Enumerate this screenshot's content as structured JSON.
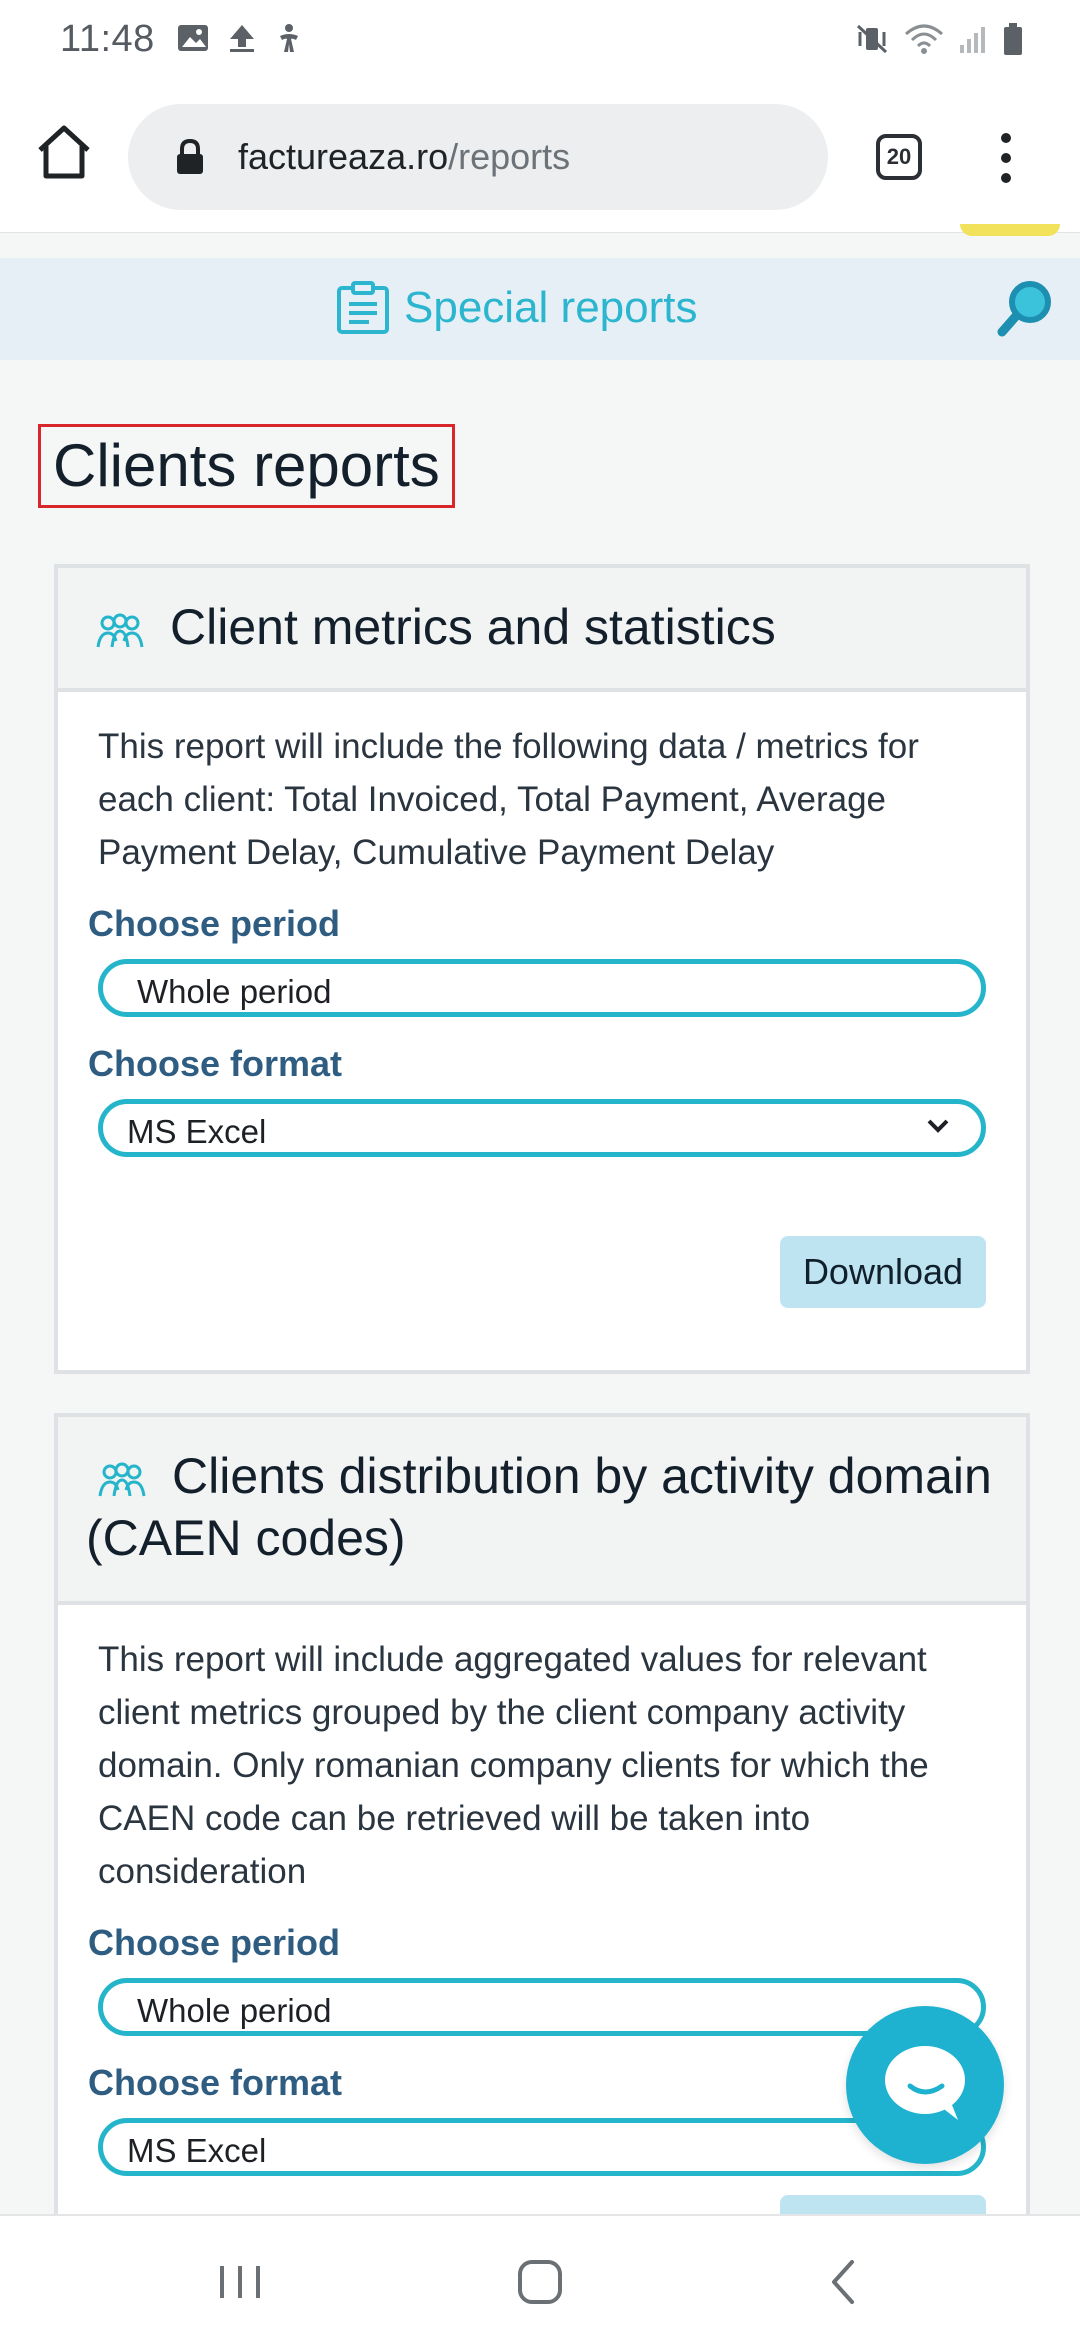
{
  "status_bar": {
    "time": "11:48",
    "left_icons": [
      "image-icon",
      "upload-icon",
      "accessibility-icon"
    ],
    "right_icons": [
      "mute-vibrate-icon",
      "wifi-icon",
      "signal-icon",
      "battery-icon"
    ]
  },
  "browser": {
    "url_host": "factureaza.ro",
    "url_path": "/reports",
    "tab_count": "20"
  },
  "page": {
    "special_reports_label": "Special reports",
    "title": "Clients reports"
  },
  "reports": [
    {
      "title": "Client metrics and statistics",
      "description": "This report will include the following data / metrics for each client: Total Invoiced, Total Payment, Average Payment Delay, Cumulative Payment Delay",
      "period_label": "Choose period",
      "period_value": "Whole period",
      "format_label": "Choose format",
      "format_value": "MS Excel",
      "download_label": "Download"
    },
    {
      "title": "Clients distribution by activity domain (CAEN codes)",
      "description": "This report will include aggregated values for relevant client metrics grouped by the client company activity domain. Only romanian company clients for which the CAEN code can be retrieved will be taken into consideration",
      "period_label": "Choose period",
      "period_value": "Whole period",
      "format_label": "Choose format",
      "format_value": "MS Excel"
    }
  ],
  "colors": {
    "accent": "#25b5cb",
    "label_blue": "#2f5d82",
    "highlight_border": "#d9262a",
    "download_bg": "#bfe4f1"
  }
}
